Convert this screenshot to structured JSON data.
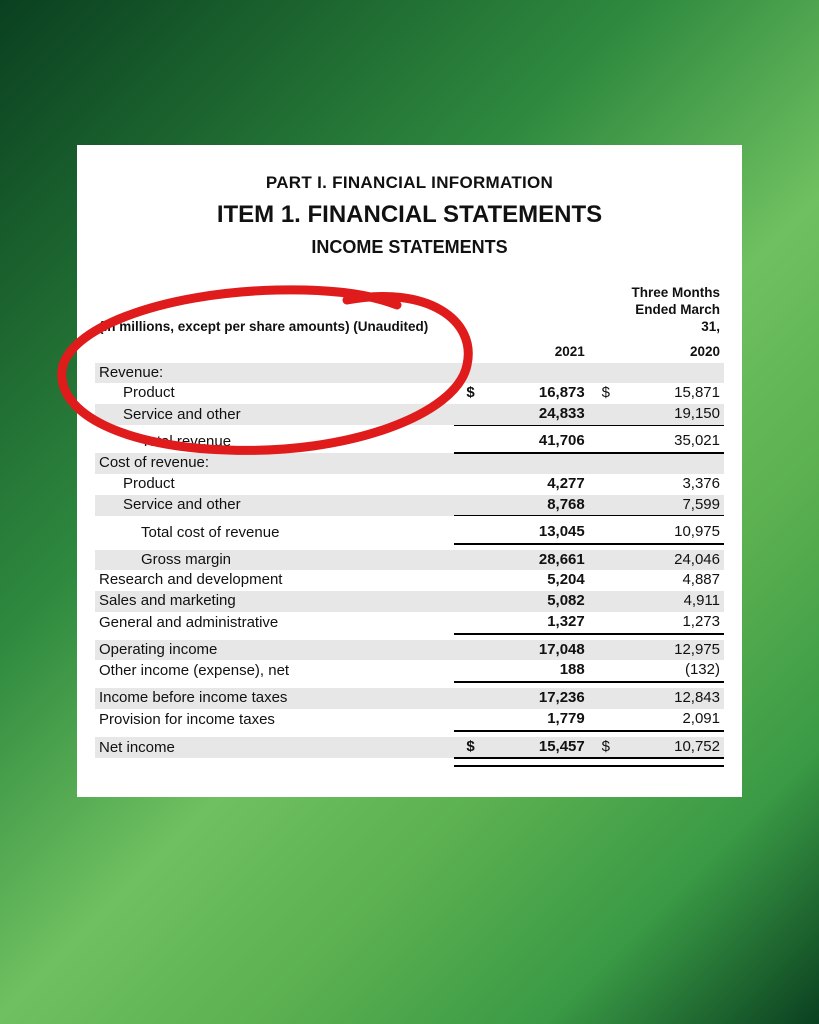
{
  "headings": {
    "part": "PART I. FINANCIAL INFORMATION",
    "item": "ITEM 1. FINANCIAL STATEMENTS",
    "statements": "INCOME STATEMENTS"
  },
  "note": "(In millions, except per share amounts) (Unaudited)",
  "period_label": "Three Months Ended March 31,",
  "years": {
    "y2021": "2021",
    "y2020": "2020"
  },
  "table": {
    "revenue_header": "Revenue:",
    "product": "Product",
    "service_other": "Service and other",
    "total_revenue": "Total revenue",
    "cost_header": "Cost of revenue:",
    "cost_product": "Product",
    "cost_service": "Service and other",
    "total_cost": "Total cost of revenue",
    "gross_margin": "Gross margin",
    "rnd": "Research and development",
    "sales_marketing": "Sales and marketing",
    "gna": "General and administrative",
    "operating_income": "Operating income",
    "other_income": "Other income (expense), net",
    "income_before_tax": "Income before income taxes",
    "provision_tax": "Provision for income taxes",
    "net_income": "Net income"
  },
  "values": {
    "product": {
      "y2021": "16,873",
      "y2020": "15,871"
    },
    "service_other": {
      "y2021": "24,833",
      "y2020": "19,150"
    },
    "total_revenue": {
      "y2021": "41,706",
      "y2020": "35,021"
    },
    "cost_product": {
      "y2021": "4,277",
      "y2020": "3,376"
    },
    "cost_service": {
      "y2021": "8,768",
      "y2020": "7,599"
    },
    "total_cost": {
      "y2021": "13,045",
      "y2020": "10,975"
    },
    "gross_margin": {
      "y2021": "28,661",
      "y2020": "24,046"
    },
    "rnd": {
      "y2021": "5,204",
      "y2020": "4,887"
    },
    "sales_marketing": {
      "y2021": "5,082",
      "y2020": "4,911"
    },
    "gna": {
      "y2021": "1,327",
      "y2020": "1,273"
    },
    "operating_income": {
      "y2021": "17,048",
      "y2020": "12,975"
    },
    "other_income": {
      "y2021": "188",
      "y2020": "(132)"
    },
    "income_before_tax": {
      "y2021": "17,236",
      "y2020": "12,843"
    },
    "provision_tax": {
      "y2021": "1,779",
      "y2020": "2,091"
    },
    "net_income": {
      "y2021": "15,457",
      "y2020": "10,752"
    }
  },
  "currency": "$"
}
